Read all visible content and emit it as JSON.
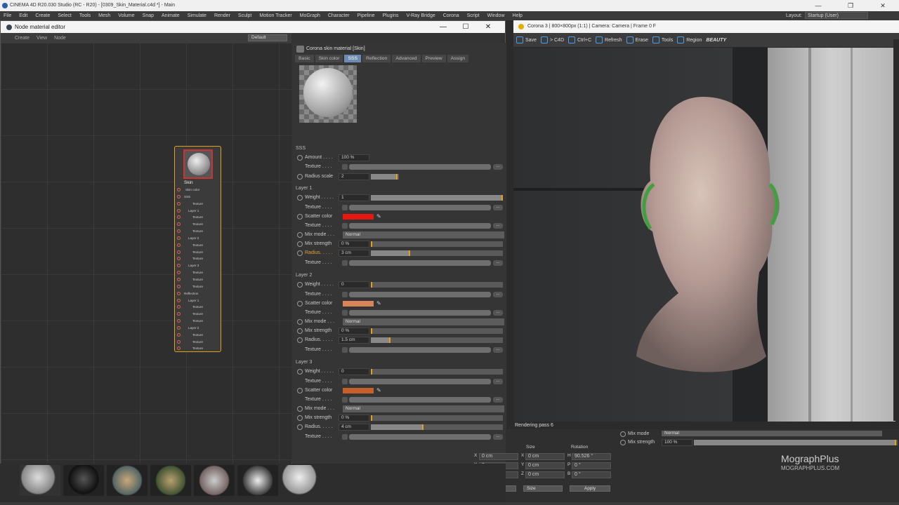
{
  "app": {
    "title": "CINEMA 4D R20.030 Studio (RC - R20) - [0309_Skin_Material.c4d *] - Main",
    "window_controls": [
      "—",
      "❐",
      "✕"
    ],
    "menus": [
      "File",
      "Edit",
      "Create",
      "Select",
      "Tools",
      "Mesh",
      "Volume",
      "Snap",
      "Animate",
      "Simulate",
      "Render",
      "Sculpt",
      "Motion Tracker",
      "MoGraph",
      "Character",
      "Pipeline",
      "Plugins",
      "V-Ray Bridge",
      "Corona",
      "Script",
      "Window",
      "Help"
    ],
    "layout_label": "Layout:",
    "layout_value": "Startup (User)"
  },
  "node_editor": {
    "title": "Node material editor",
    "menu": [
      "Create",
      "View",
      "Node"
    ],
    "preset": "Default",
    "node": {
      "name": "Skin",
      "ports": [
        "Skin color",
        "SSS",
        "Texture",
        "Layer 1",
        "Texture",
        "Texture",
        "Texture",
        "Layer 2",
        "Texture",
        "Texture",
        "Texture",
        "Layer 3",
        "Texture",
        "Texture",
        "Texture",
        "Reflection",
        "Layer 1",
        "Texture",
        "Texture",
        "Texture",
        "Layer 2",
        "Texture",
        "Texture",
        "Texture"
      ]
    }
  },
  "attributes": {
    "header": "Corona skin material [Skin]",
    "tabs": [
      "Basic",
      "Skin color",
      "SSS",
      "Reflection",
      "Advanced",
      "Preview",
      "Assign"
    ],
    "active_tab": "SSS",
    "section": "SSS",
    "sss": {
      "amount_label": "Amount . . . .",
      "amount_value": "100 %",
      "texture_label": "Texture . . . .",
      "radius_scale_label": "Radius scale",
      "radius_scale_value": "2"
    },
    "layers": [
      {
        "title": "Layer 1",
        "weight_label": "Weight . . . . .",
        "weight_value": "1",
        "weight_fill": 1.0,
        "texture_label": "Texture . . . .",
        "scatter_label": "Scatter color",
        "scatter_color": "#e8170f",
        "mix_mode_label": "Mix mode . . .",
        "mix_mode_value": "Normal",
        "mix_strength_label": "Mix strength",
        "mix_strength_value": "0 %",
        "radius_label": "Radius. . . . .",
        "radius_value": "3 cm",
        "radius_fill": 0.3
      },
      {
        "title": "Layer 2",
        "weight_label": "Weight . . . . .",
        "weight_value": "0",
        "weight_fill": 0.0,
        "texture_label": "Texture . . . .",
        "scatter_label": "Scatter color",
        "scatter_color": "#d9845a",
        "mix_mode_label": "Mix mode . . .",
        "mix_mode_value": "Normal",
        "mix_strength_label": "Mix strength",
        "mix_strength_value": "0 %",
        "radius_label": "Radius. . . . .",
        "radius_value": "1.5 cm",
        "radius_fill": 0.15
      },
      {
        "title": "Layer 3",
        "weight_label": "Weight . . . . .",
        "weight_value": "0",
        "weight_fill": 0.0,
        "texture_label": "Texture . . . .",
        "scatter_label": "Scatter color",
        "scatter_color": "#c8602a",
        "mix_mode_label": "Mix mode . . .",
        "mix_mode_value": "Normal",
        "mix_strength_label": "Mix strength",
        "mix_strength_value": "0 %",
        "radius_label": "Radius. . . . .",
        "radius_value": "4 cm",
        "radius_fill": 0.4
      }
    ]
  },
  "render_window": {
    "title": "Corona 3 | 800×800px (1:1) | Camera: Camera | Frame 0 F",
    "toolbar": [
      "Save",
      "> C4D",
      "Ctrl+C",
      "Refresh",
      "Erase",
      "Tools",
      "Region"
    ],
    "pass": "BEAUTY",
    "status": "Rendering pass 6"
  },
  "lower": {
    "mix_mode_label": "Mix mode",
    "mix_mode_value": "Normal",
    "mix_strength_label": "Mix strength",
    "mix_strength_value": "100 %",
    "size_label": "Size",
    "rotation_label": "Rotation",
    "coords": [
      {
        "axis": "X",
        "pos": "0 cm",
        "size": "0 cm",
        "rot_axis": "H",
        "rot": "90.526 °"
      },
      {
        "axis": "Y",
        "pos": "0 cm",
        "size": "0 cm",
        "rot_axis": "P",
        "rot": "0 °"
      },
      {
        "axis": "Z",
        "pos": "0 cm",
        "size": "0 cm",
        "rot_axis": "B",
        "rot": "0 °"
      }
    ],
    "object_mode": "Object (Rel)",
    "size_mode": "Size",
    "apply": "Apply"
  },
  "brand": {
    "line1": "MographPlus",
    "line2": "MOGRAPHPLUS.COM"
  },
  "colors": {
    "accent": "#e0a020",
    "tab_active": "#6d8ab0",
    "node_border": "#e0a020"
  }
}
